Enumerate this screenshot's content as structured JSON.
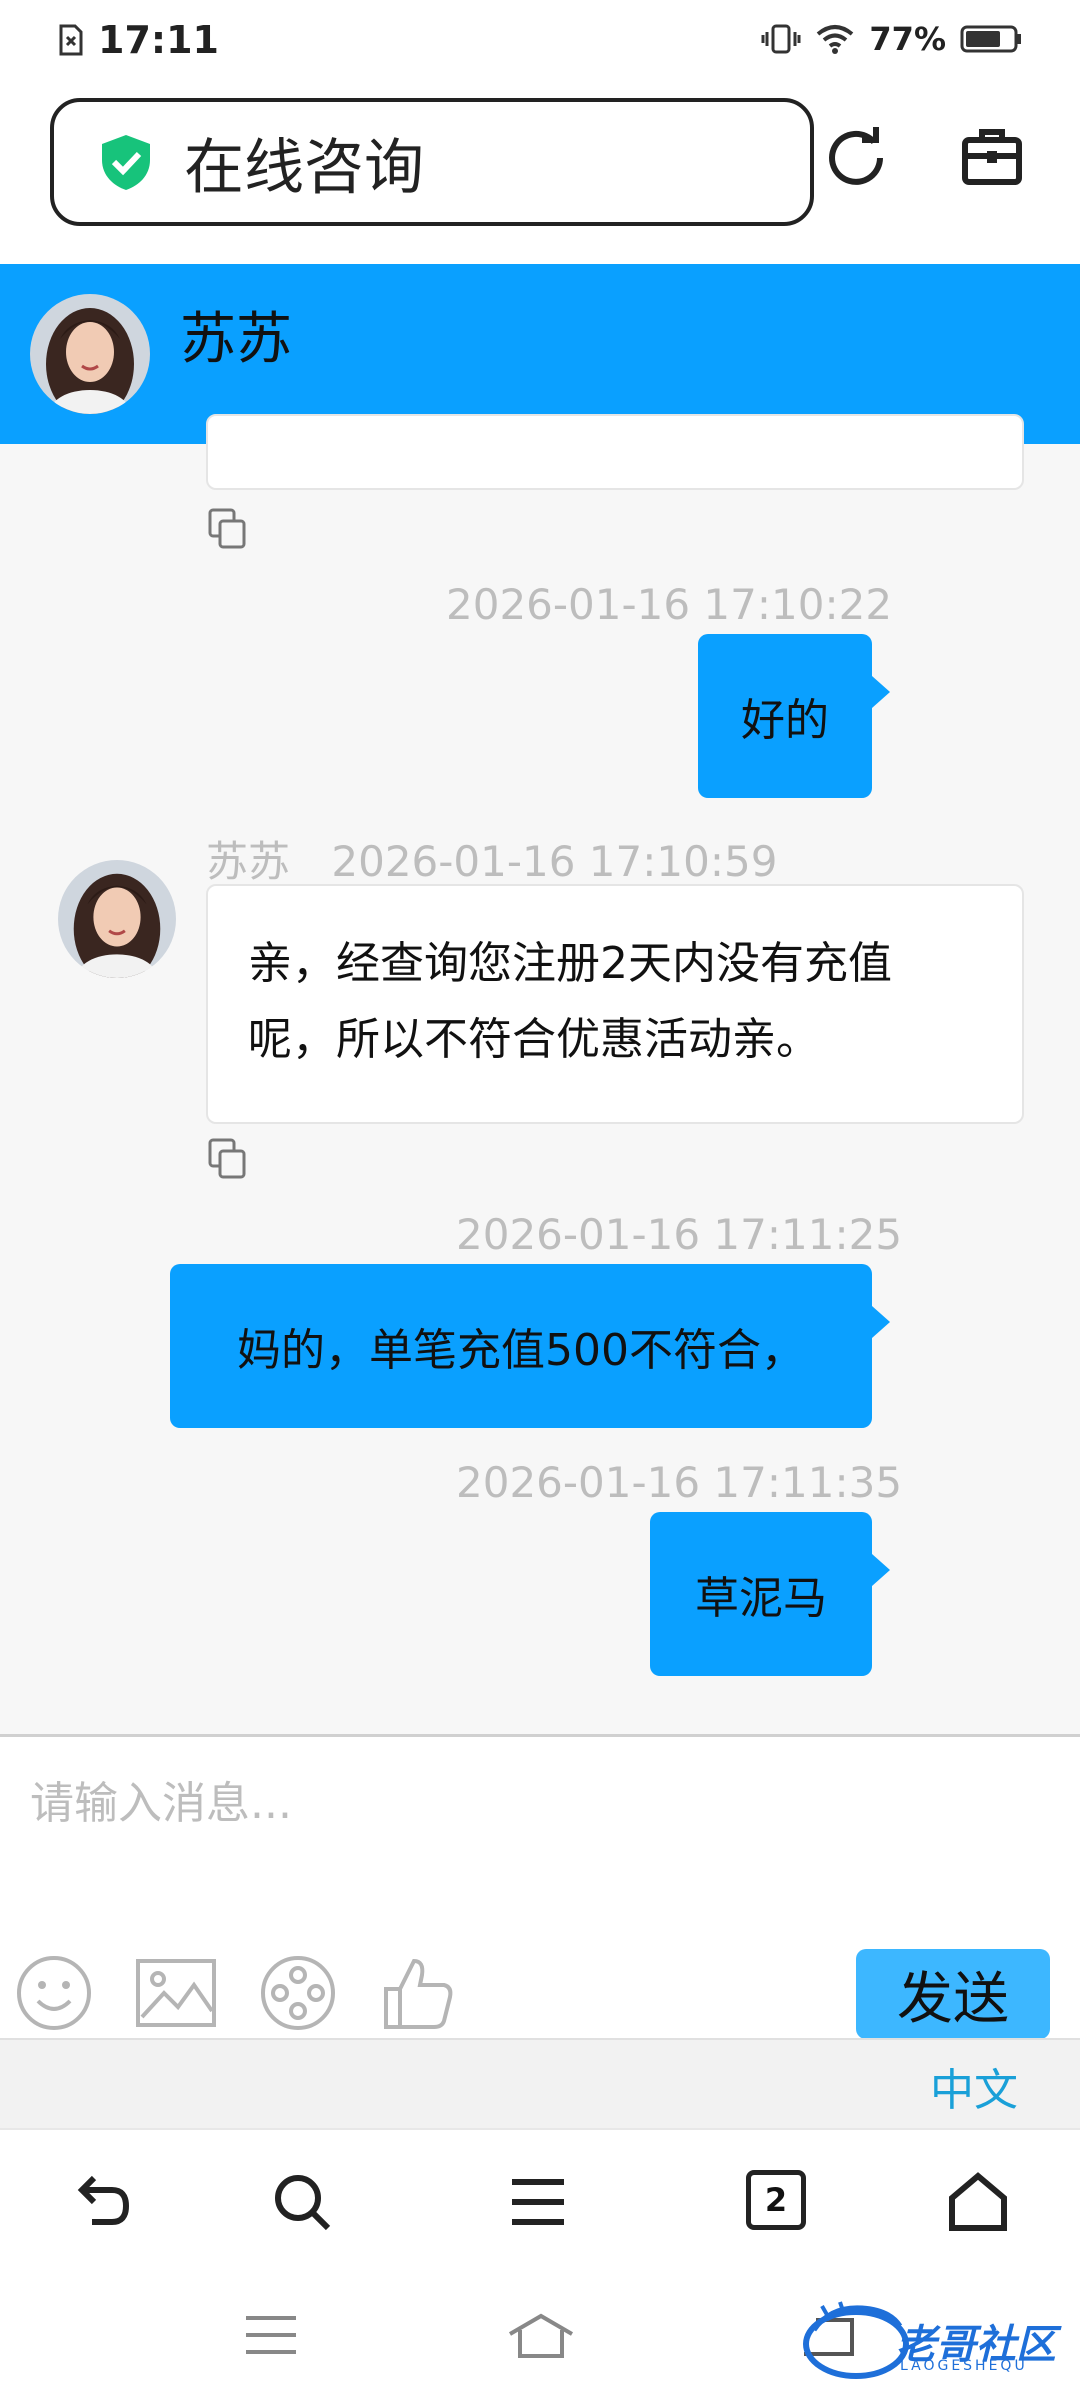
{
  "status": {
    "time": "17:11",
    "battery": "77%"
  },
  "address": {
    "title": "在线咨询"
  },
  "header": {
    "name": "苏苏"
  },
  "messages": [
    {
      "side": "right",
      "time": "2026-01-16 17:10:22",
      "text": "好的"
    },
    {
      "side": "left",
      "sender": "苏苏",
      "time": "2026-01-16 17:10:59",
      "line1": "亲，经查询您注册2天内没有充值",
      "line2": "呢，所以不符合优惠活动亲。"
    },
    {
      "side": "right",
      "time": "2026-01-16 17:11:25",
      "text": "妈的，单笔充值500不符合，"
    },
    {
      "side": "right",
      "time": "2026-01-16 17:11:35",
      "text": "草泥马"
    }
  ],
  "input": {
    "placeholder": "请输入消息..."
  },
  "send_label": "发送",
  "lang_label": "中文",
  "tabs_count": "2",
  "watermark": {
    "text": "老哥社区",
    "sub": "LAOGESHEQU"
  },
  "colors": {
    "accent": "#0aa0ff",
    "send": "#3db7ff",
    "lang": "#1aa0d8"
  }
}
